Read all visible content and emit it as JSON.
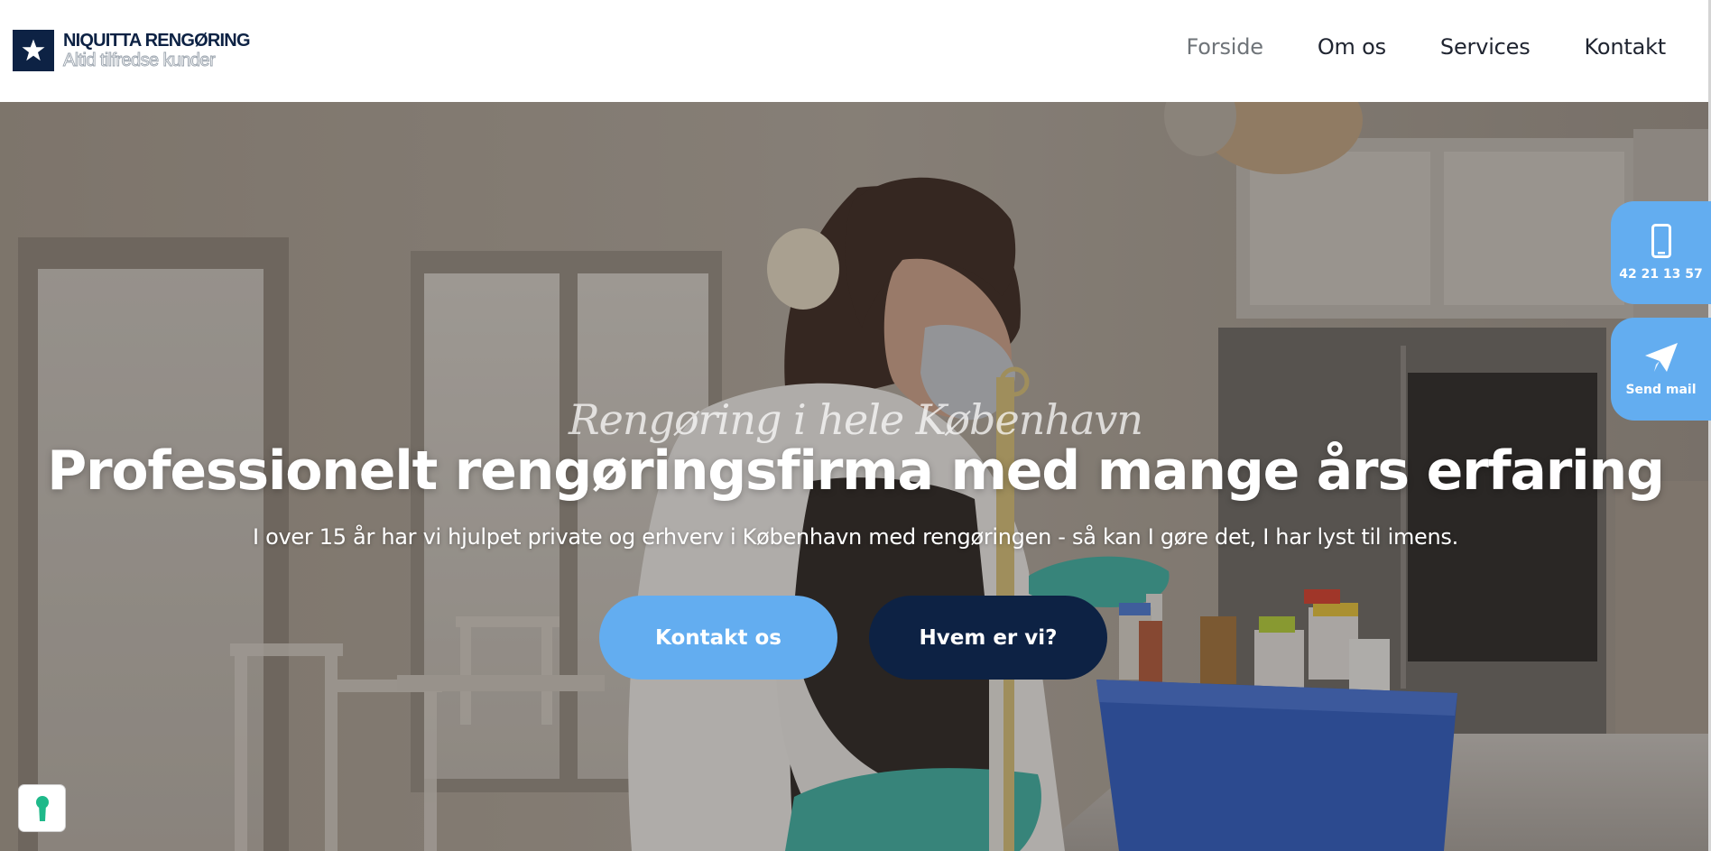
{
  "brand": {
    "name": "NIQUITTA RENGØRING",
    "tagline": "Altid tilfredse kunder"
  },
  "nav": {
    "items": [
      {
        "label": "Forside",
        "active": true
      },
      {
        "label": "Om os",
        "active": false
      },
      {
        "label": "Services",
        "active": false
      },
      {
        "label": "Kontakt",
        "active": false
      }
    ]
  },
  "hero": {
    "script": "Rengøring i hele København",
    "title": "Professionelt rengøringsfirma med mange års erfaring",
    "subtitle": "I over 15 år har vi hjulpet private og erhverv i København med rengøringen - så kan I gøre det, I har lyst til imens.",
    "primary_button": "Kontakt os",
    "secondary_button": "Hvem er vi?"
  },
  "floating": {
    "phone_label": "42 21 13 57",
    "mail_label": "Send mail"
  },
  "icons": {
    "logo": "star-icon",
    "phone": "phone-icon",
    "mail": "paper-plane-icon",
    "cookie": "keyhole-icon"
  },
  "colors": {
    "navy": "#0d2244",
    "accent_blue": "#63adf0",
    "cookie_green": "#1fb98a"
  }
}
